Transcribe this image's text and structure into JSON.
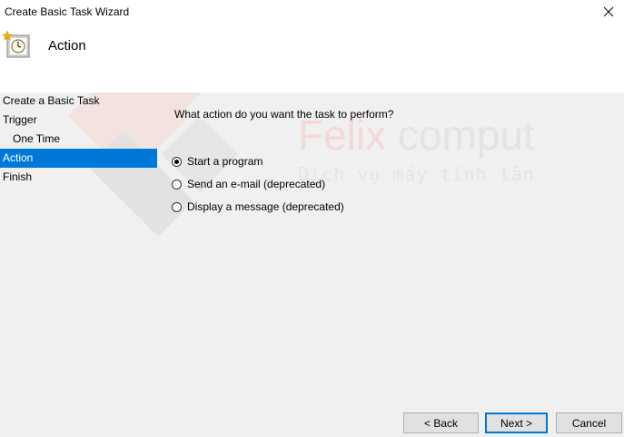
{
  "window": {
    "title": "Create Basic Task Wizard"
  },
  "header": {
    "title": "Action"
  },
  "nav": {
    "items": [
      {
        "label": "Create a Basic Task"
      },
      {
        "label": "Trigger"
      },
      {
        "label": "One Time"
      },
      {
        "label": "Action"
      },
      {
        "label": "Finish"
      }
    ],
    "selected": "Action"
  },
  "main": {
    "question": "What action do you want the task to perform?",
    "options": [
      {
        "label": "Start a program",
        "checked": true
      },
      {
        "label": "Send an e-mail (deprecated)",
        "checked": false
      },
      {
        "label": "Display a message (deprecated)",
        "checked": false
      }
    ]
  },
  "buttons": {
    "back": "< Back",
    "next": "Next >",
    "cancel": "Cancel"
  },
  "watermark": {
    "brand_red": "Felix",
    "brand_gray": " comput",
    "tagline": "Dịch vụ máy tính tận"
  },
  "colors": {
    "selection": "#0078d7",
    "watermark_red": "#f4d9d6",
    "watermark_gray": "#e4e4e4"
  },
  "icons": {
    "close": "close-icon",
    "task": "scheduled-task-clock-icon"
  }
}
